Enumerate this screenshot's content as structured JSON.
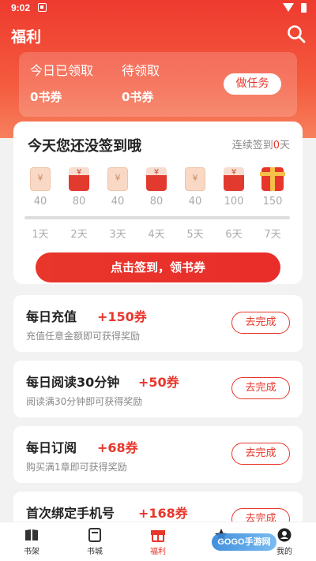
{
  "status_bar": {
    "time": "9:02"
  },
  "header": {
    "title": "福利"
  },
  "summary": {
    "claimed_label": "今日已领取",
    "claimed_value": "0书券",
    "pending_label": "待领取",
    "pending_value": "0书券",
    "task_button": "做任务"
  },
  "signin": {
    "title": "今天您还没签到哦",
    "streak_prefix": "连续签到",
    "streak_days": "0",
    "streak_suffix": "天",
    "days": [
      {
        "amount": "40",
        "label": "1天",
        "icon": "ticket"
      },
      {
        "amount": "80",
        "label": "2天",
        "icon": "red-envelope"
      },
      {
        "amount": "40",
        "label": "3天",
        "icon": "ticket"
      },
      {
        "amount": "80",
        "label": "4天",
        "icon": "red-envelope"
      },
      {
        "amount": "40",
        "label": "5天",
        "icon": "ticket"
      },
      {
        "amount": "100",
        "label": "6天",
        "icon": "red-envelope"
      },
      {
        "amount": "150",
        "label": "7天",
        "icon": "gift-box"
      }
    ],
    "progress": 0,
    "button": "点击签到，领书券"
  },
  "tasks": [
    {
      "title": "每日充值",
      "reward": "+150券",
      "desc": "充值任意金额即可获得奖励",
      "button": "去完成"
    },
    {
      "title": "每日阅读30分钟",
      "reward": "+50券",
      "desc": "阅读满30分钟即可获得奖励",
      "button": "去完成"
    },
    {
      "title": "每日订阅",
      "reward": "+68券",
      "desc": "购买满1章即可获得奖励",
      "button": "去完成"
    },
    {
      "title": "首次绑定手机号",
      "reward": "+168券",
      "desc": "",
      "button": "去完成"
    }
  ],
  "bottom_nav": [
    {
      "label": "书架",
      "icon": "bookshelf-icon"
    },
    {
      "label": "书城",
      "icon": "bookstore-icon"
    },
    {
      "label": "福利",
      "icon": "gift-icon",
      "active": true
    },
    {
      "label": "",
      "icon": "star-icon"
    },
    {
      "label": "我的",
      "icon": "profile-icon"
    }
  ],
  "watermark": "GOGO手游网",
  "colors": {
    "accent": "#e8362b",
    "header_top": "#ee3a2f",
    "header_bottom": "#f7805d"
  }
}
